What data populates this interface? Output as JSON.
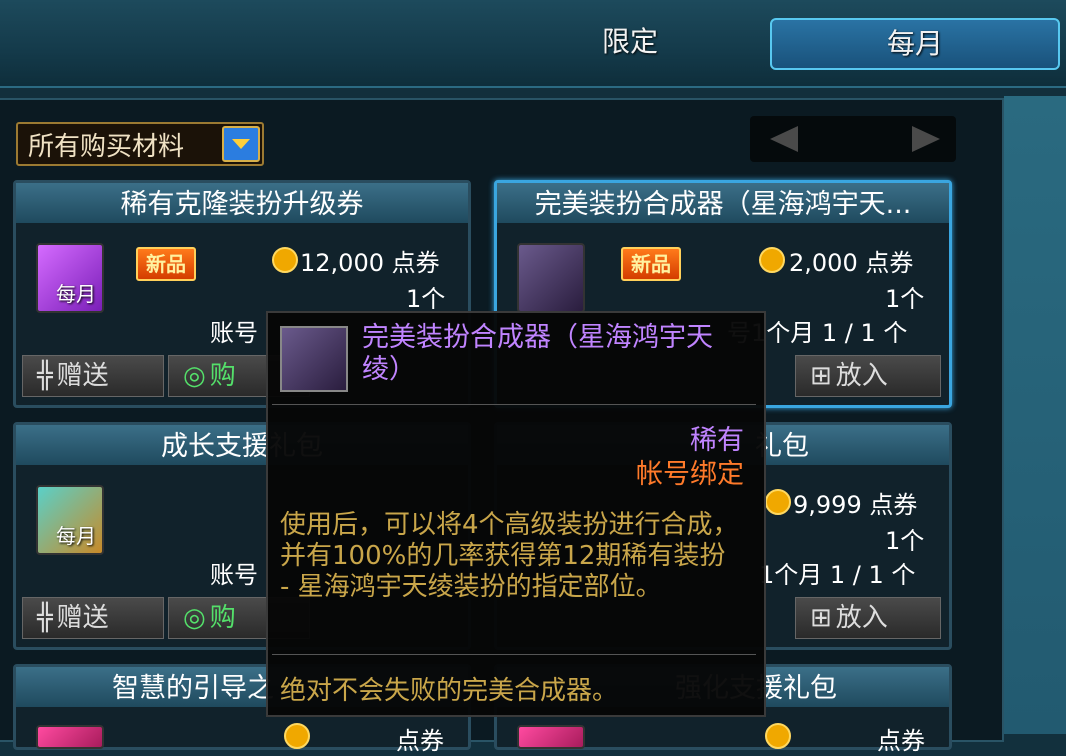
{
  "tabs": {
    "limited": "限定",
    "monthly": "每月"
  },
  "filter": {
    "label": "所有购买材料"
  },
  "cards": [
    {
      "title": "稀有克隆装扮升级券",
      "icon_tag": "每月",
      "badge": "新品",
      "price": "12,000 点券",
      "qty": "1个",
      "limit": "账号",
      "gift": "赠送",
      "buy": "购"
    },
    {
      "title": "完美装扮合成器（星海鸿宇天...",
      "badge": "新品",
      "price": "2,000 点券",
      "qty": "1个",
      "limit": "号1个月 1 / 1 个",
      "cart": "放入"
    },
    {
      "title": "成长支援礼包",
      "icon_tag": "每月",
      "limit": "账号",
      "gift": "赠送",
      "buy": "购"
    },
    {
      "title": "礼包",
      "price": "9,999 点券",
      "qty": "1个",
      "limit": "1个月 1 / 1 个",
      "cart": "放入"
    },
    {
      "title": "智慧的引导之",
      "price": "点券"
    },
    {
      "title": "强化支援礼包",
      "price": "点券"
    }
  ],
  "tooltip": {
    "title": "完美装扮合成器（星海鸿宇天绫）",
    "rarity": "稀有",
    "bind": "帐号绑定",
    "description": "使用后，可以将4个高级装扮进行合成，并有100%的几率获得第12期稀有装扮 - 星海鸿宇天绫装扮的指定部位。",
    "footer": "绝对不会失败的完美合成器。"
  },
  "colors": {
    "rarity": "#c084ff",
    "bind": "#ff7a2a",
    "desc": "#c9a64a",
    "accent": "#3aa6e0"
  }
}
